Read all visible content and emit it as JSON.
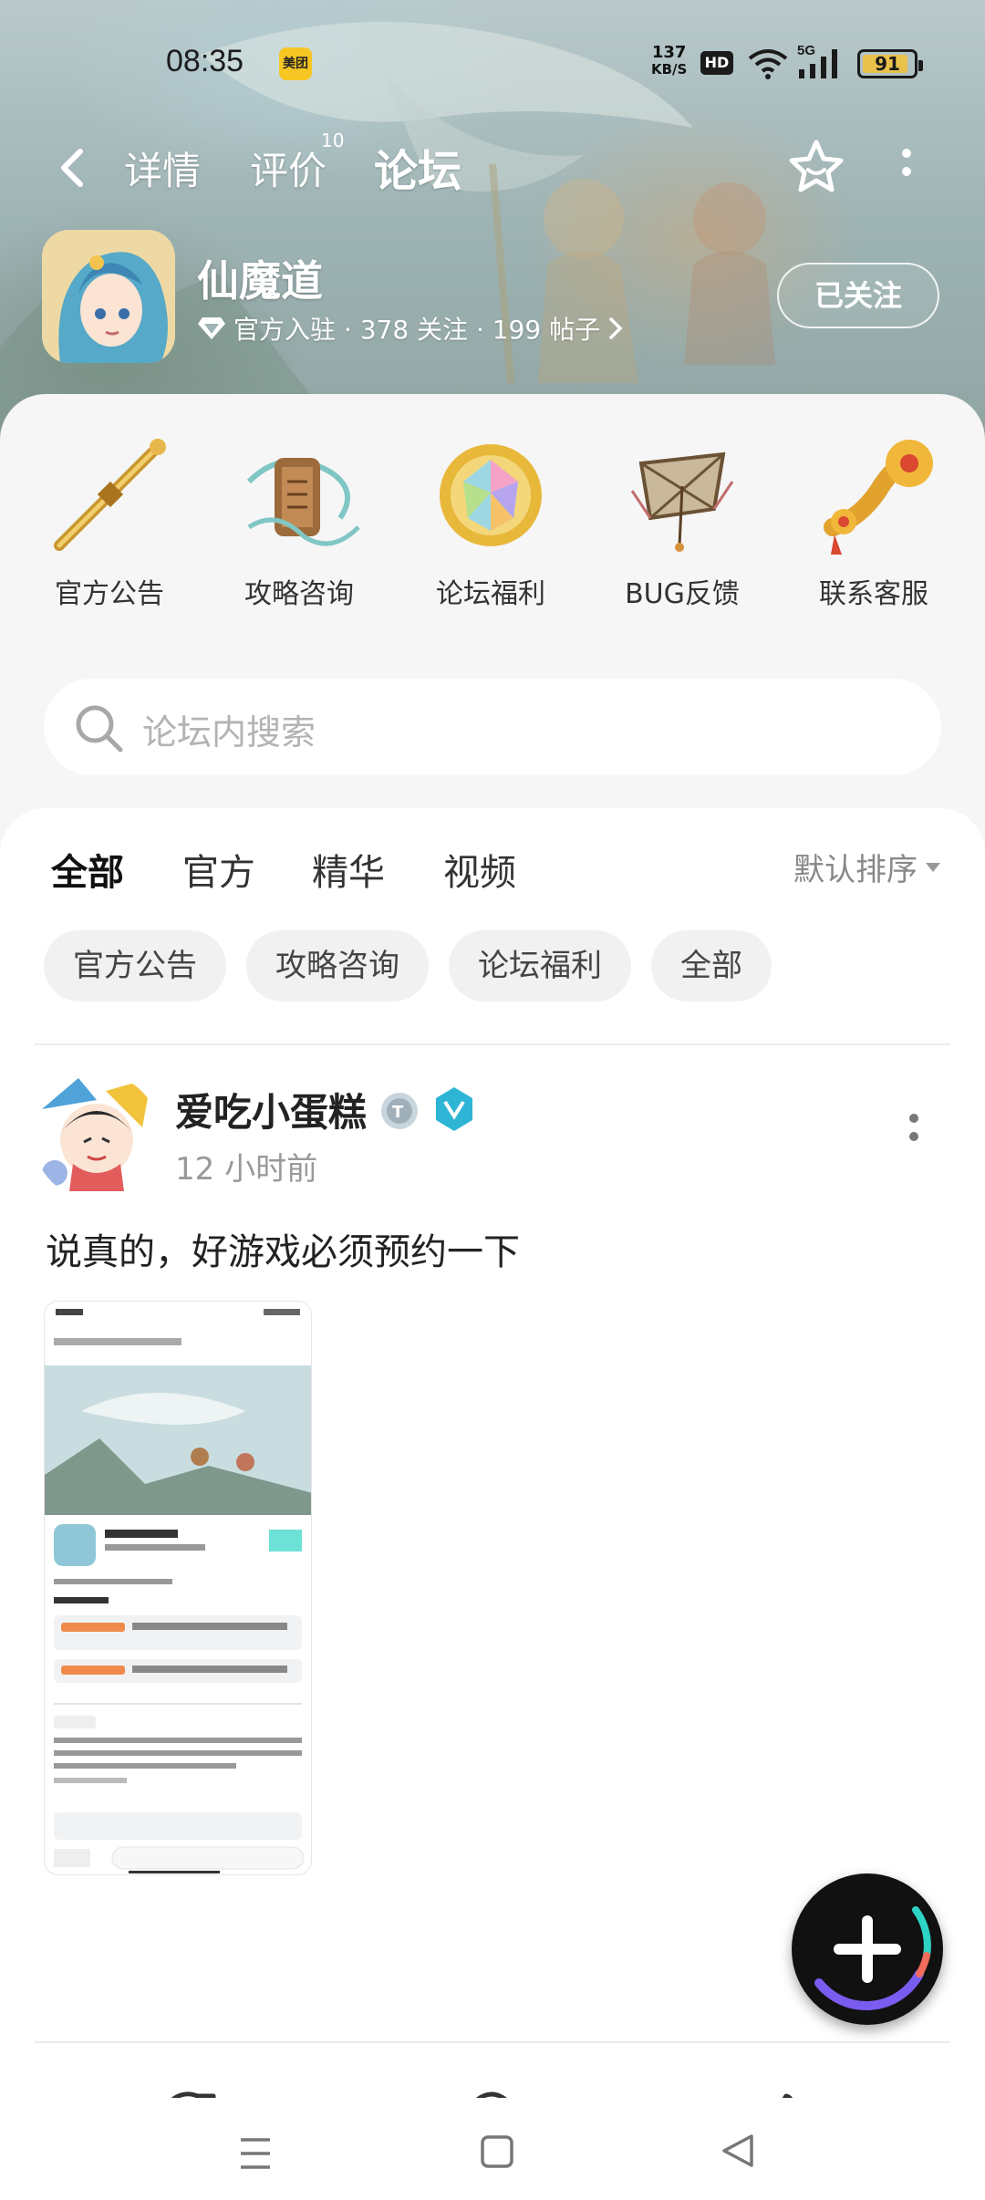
{
  "status_bar": {
    "time": "08:35",
    "app_badge": "美团",
    "net_speed_value": "137",
    "net_speed_unit": "KB/S",
    "hd": "HD",
    "network": "5G",
    "battery": "91",
    "battery_level": 0.91
  },
  "nav": {
    "tabs": [
      {
        "label": "详情"
      },
      {
        "label": "评价",
        "count": "10"
      },
      {
        "label": "论坛"
      }
    ],
    "active_tab": "论坛",
    "accent_color": "#2dd4c4"
  },
  "game": {
    "name": "仙魔道",
    "meta": "官方入驻 · 378 关注 · 199 帖子",
    "follow_label": "已关注"
  },
  "categories": [
    {
      "label": "官方公告",
      "icon": "golden-staff-icon"
    },
    {
      "label": "攻略咨询",
      "icon": "scroll-icon"
    },
    {
      "label": "论坛福利",
      "icon": "gem-icon"
    },
    {
      "label": "BUG反馈",
      "icon": "bug-kite-icon"
    },
    {
      "label": "联系客服",
      "icon": "ruyi-icon"
    }
  ],
  "search": {
    "placeholder": "论坛内搜索"
  },
  "feed": {
    "tabs": [
      {
        "label": "全部"
      },
      {
        "label": "官方"
      },
      {
        "label": "精华"
      },
      {
        "label": "视频"
      }
    ],
    "active_tab": "全部",
    "sort_label": "默认排序",
    "chips": [
      "官方公告",
      "攻略咨询",
      "论坛福利",
      "全部"
    ]
  },
  "post": {
    "author": "爱吃小蛋糕",
    "time": "12 小时前",
    "text": "说真的，好游戏必须预约一下"
  }
}
